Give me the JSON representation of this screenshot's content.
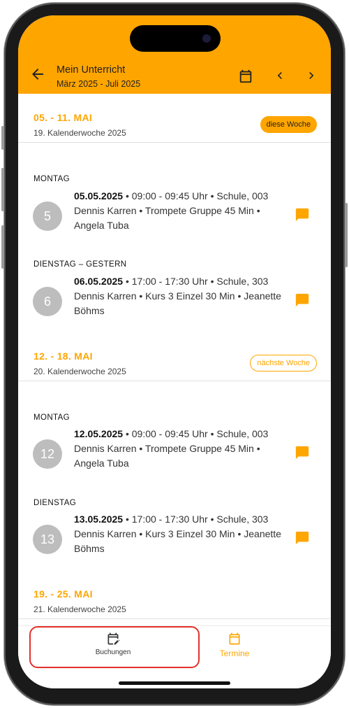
{
  "header": {
    "title": "Mein Unterricht",
    "subtitle": "März 2025 - Juli 2025"
  },
  "weeks": [
    {
      "range": "05. - 11. MAI",
      "cw": "19. Kalenderwoche 2025",
      "badge": "diese Woche",
      "days": [
        {
          "label": "MONTAG",
          "num": "5",
          "date": "05.05.2025",
          "info": " • 09:00 - 09:45 Uhr • Schule, 003",
          "line2": "Dennis Karren • Trompete Gruppe 45 Min •",
          "line3": "Angela Tuba"
        },
        {
          "label": "DIENSTAG – GESTERN",
          "num": "6",
          "date": "06.05.2025",
          "info": " • 17:00 - 17:30 Uhr • Schule, 303",
          "line2": "Dennis Karren • Kurs 3 Einzel 30 Min • Jeanette",
          "line3": "Böhms"
        }
      ]
    },
    {
      "range": "12. - 18. MAI",
      "cw": "20. Kalenderwoche 2025",
      "badge": "nächste Woche",
      "days": [
        {
          "label": "MONTAG",
          "num": "12",
          "date": "12.05.2025",
          "info": " • 09:00 - 09:45 Uhr • Schule, 003",
          "line2": "Dennis Karren • Trompete Gruppe 45 Min •",
          "line3": "Angela Tuba"
        },
        {
          "label": "DIENSTAG",
          "num": "13",
          "date": "13.05.2025",
          "info": " • 17:00 - 17:30 Uhr • Schule, 303",
          "line2": "Dennis Karren • Kurs 3 Einzel 30 Min • Jeanette",
          "line3": "Böhms"
        }
      ]
    },
    {
      "range": "19. - 25. MAI",
      "cw": "21. Kalenderwoche 2025"
    }
  ],
  "nav": {
    "bookings": "Buchungen",
    "appointments": "Termine"
  },
  "icons": {
    "back": "arrow-left-icon",
    "calendar": "calendar-icon",
    "prev": "chevron-left-icon",
    "next": "chevron-right-icon",
    "chat": "chat-icon",
    "bookings": "calendar-edit-icon",
    "appointments": "calendar-icon"
  },
  "colors": {
    "accent": "#FFA500",
    "highlight": "#e4302a",
    "avatar": "#bdbdbd"
  }
}
